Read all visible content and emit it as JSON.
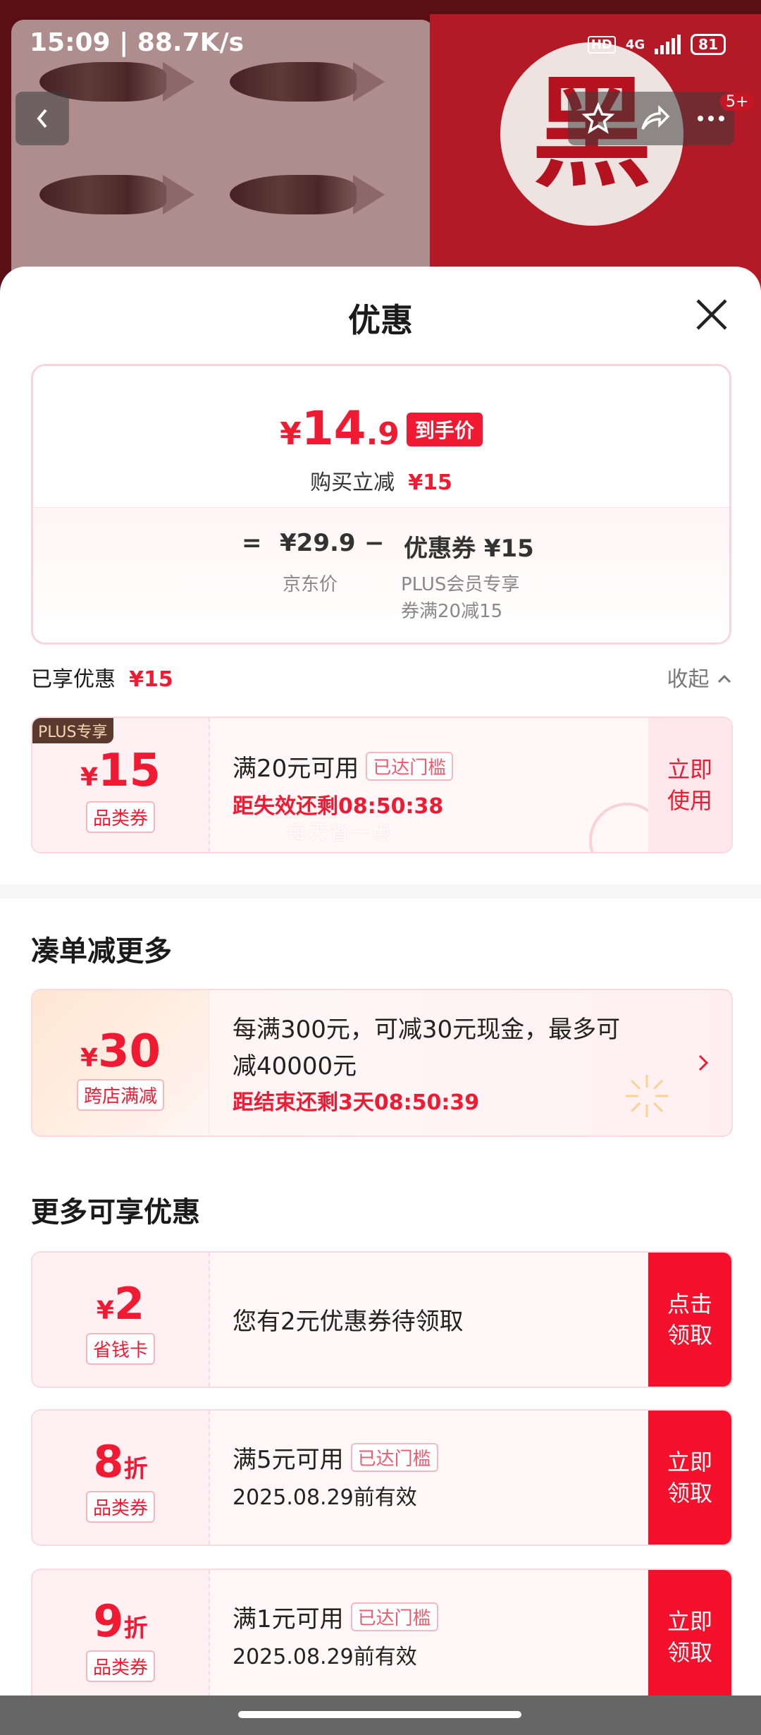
{
  "status": {
    "time_speed": "15:09 | 88.7K/s",
    "hd": "HD",
    "network": "4G",
    "battery": "81"
  },
  "header": {
    "char": "黑",
    "badge": "5+"
  },
  "sheet": {
    "title": "优惠"
  },
  "price": {
    "yen": "¥",
    "int": "14",
    "dec": ".9",
    "tag": "到手价",
    "buy_label": "购买立减",
    "buy_amount": "¥15",
    "eq": "=",
    "jd_price": "¥29.9",
    "minus": "−",
    "coupon_text": "优惠券 ¥15",
    "jd_label": "京东价",
    "plus_line1": "PLUS会员专享",
    "plus_line2": "券满20减15"
  },
  "enjoyed": {
    "label": "已享优惠",
    "amount": "¥15",
    "collapse": "收起"
  },
  "coupons_enjoyed": [
    {
      "tag": "PLUS专享",
      "yen": "¥",
      "amount": "15",
      "type": "品类券",
      "title": "满20元可用",
      "threshold": "已达门槛",
      "countdown": "距失效还剩08:50:38",
      "button_1": "立即",
      "button_2": "使用",
      "watermark": "每天省一点"
    }
  ],
  "section_more": {
    "title": "凑单减更多"
  },
  "cross_store": {
    "yen": "¥",
    "amount": "30",
    "type": "跨店满减",
    "line1": "每满300元，可减30元现金，最多可",
    "line2": "减40000元",
    "countdown": "距结束还剩3天08:50:39"
  },
  "section_other": {
    "title": "更多可享优惠"
  },
  "other_coupons": [
    {
      "yen": "¥",
      "amount": "2",
      "unit": "",
      "type": "省钱卡",
      "title": "您有2元优惠券待领取",
      "threshold": "",
      "validity": "",
      "button_1": "点击",
      "button_2": "领取"
    },
    {
      "yen": "",
      "amount": "8",
      "unit": "折",
      "type": "品类券",
      "title": "满5元可用",
      "threshold": "已达门槛",
      "validity": "2025.08.29前有效",
      "button_1": "立即",
      "button_2": "领取"
    },
    {
      "yen": "",
      "amount": "9",
      "unit": "折",
      "type": "品类券",
      "title": "满1元可用",
      "threshold": "已达门槛",
      "validity": "2025.08.29前有效",
      "button_1": "立即",
      "button_2": "领取"
    }
  ],
  "colors": {
    "accent": "#f01b33",
    "button_red": "#f5102c",
    "plus_brown": "#5a3a2e"
  }
}
